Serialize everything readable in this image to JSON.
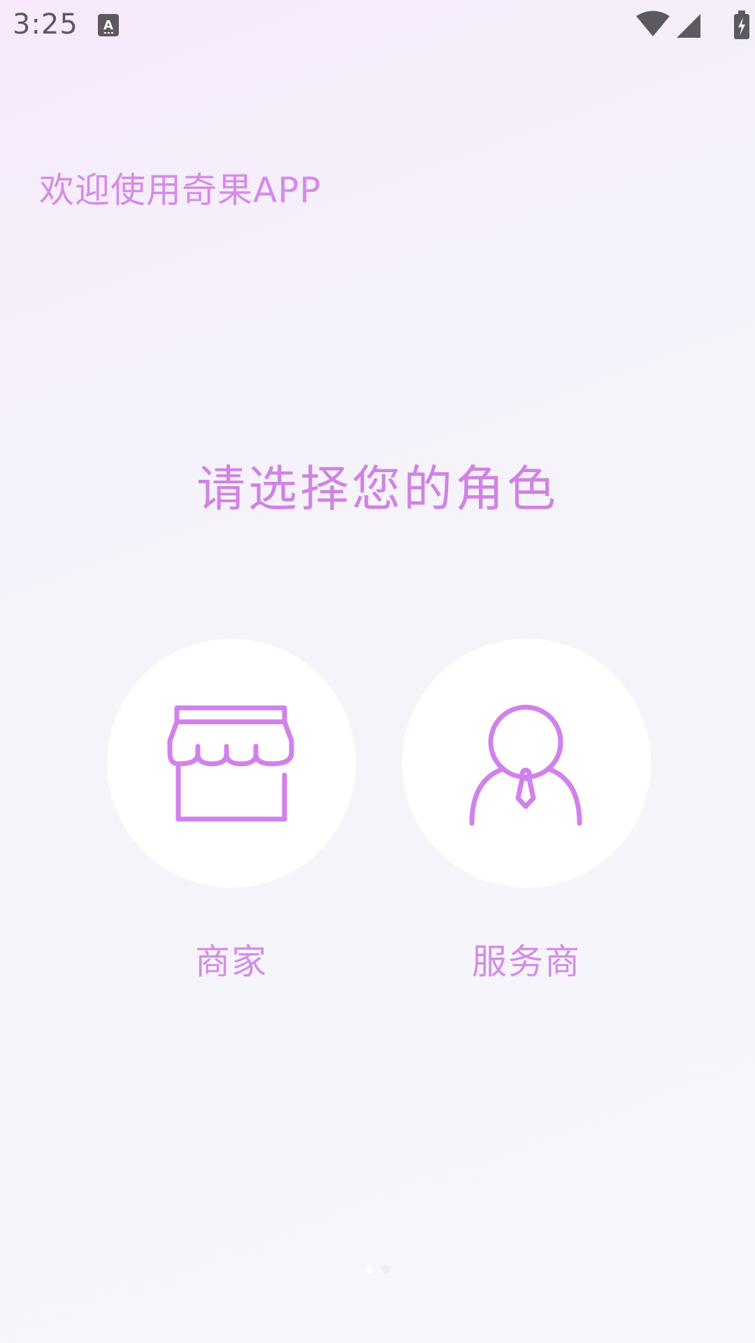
{
  "status_bar": {
    "time": "3:25",
    "notification_icon": "a-keyboard-icon",
    "icons": [
      "wifi-icon",
      "cell-signal-icon",
      "battery-charging-icon"
    ]
  },
  "header": {
    "welcome": "欢迎使用奇果APP"
  },
  "main": {
    "prompt": "请选择您的角色",
    "roles": [
      {
        "label": "商家",
        "icon": "storefront-icon"
      },
      {
        "label": "服务商",
        "icon": "person-with-tie-icon"
      }
    ]
  },
  "pager": {
    "page_count": 2,
    "current": 1
  },
  "colors": {
    "accent": "#d48ce7",
    "icon_stroke": "#d181eb",
    "card_bg": "#ffffff",
    "status_text": "#5c5a60"
  }
}
